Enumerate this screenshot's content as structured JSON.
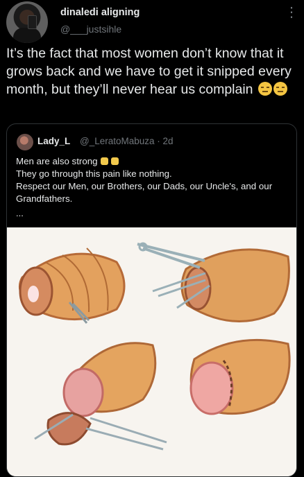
{
  "author": {
    "display_name": "dinaledi aligning",
    "handle": "@___justsihle"
  },
  "tweet": {
    "text": "It’s the fact that most women don’t know that it grows back and we have to get it snipped every month, but they’ll never hear us complain"
  },
  "icons": {
    "more": "more-vertical-icon",
    "emoji": "expressionless-face-emoji",
    "relieved": "relieved-face-emoji"
  },
  "quoted": {
    "name": "Lady_L",
    "handle": "@_LeratoMabuza",
    "time": "2d",
    "lines": [
      "Men are also strong",
      "They go through this pain like nothing.",
      "Respect our Men, our Brothers, our Dads, our Uncle's, and our",
      "Grandfathers."
    ],
    "ellipsis": "..."
  },
  "media": {
    "description_icon": "surgery-illustration"
  },
  "colors": {
    "background": "#000000",
    "text": "#e7e9ea",
    "secondary": "#71767b",
    "border": "#2f3336"
  }
}
